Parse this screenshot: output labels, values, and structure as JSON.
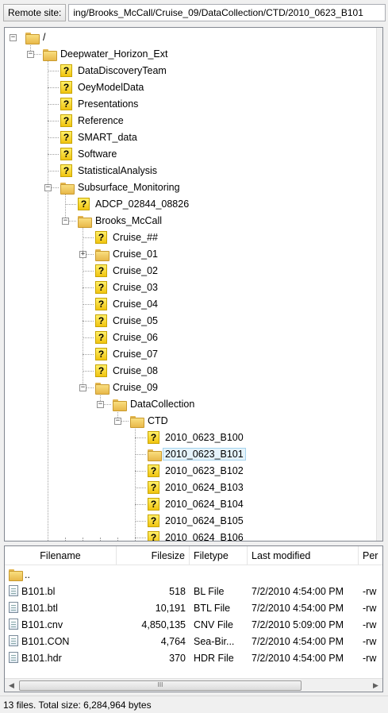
{
  "remote_site": {
    "label": "Remote site:",
    "path": "ing/Brooks_McCall/Cruise_09/DataCollection/CTD/2010_0623_B101"
  },
  "tree": {
    "nodes": [
      {
        "label": "/",
        "icon": "folder",
        "state": "expanded"
      },
      {
        "label": "Deepwater_Horizon_Ext",
        "icon": "folder",
        "state": "expanded"
      },
      {
        "label": "DataDiscoveryTeam",
        "icon": "unknown-folder"
      },
      {
        "label": "OeyModelData",
        "icon": "unknown-folder"
      },
      {
        "label": "Presentations",
        "icon": "unknown-folder"
      },
      {
        "label": "Reference",
        "icon": "unknown-folder"
      },
      {
        "label": "SMART_data",
        "icon": "unknown-folder"
      },
      {
        "label": "Software",
        "icon": "unknown-folder"
      },
      {
        "label": "StatisticalAnalysis",
        "icon": "unknown-folder"
      },
      {
        "label": "Subsurface_Monitoring",
        "icon": "folder",
        "state": "expanded"
      },
      {
        "label": "ADCP_02844_08826",
        "icon": "unknown-folder"
      },
      {
        "label": "Brooks_McCall",
        "icon": "folder",
        "state": "expanded"
      },
      {
        "label": "Cruise_##",
        "icon": "unknown-folder"
      },
      {
        "label": "Cruise_01",
        "icon": "folder",
        "state": "collapsed"
      },
      {
        "label": "Cruise_02",
        "icon": "unknown-folder"
      },
      {
        "label": "Cruise_03",
        "icon": "unknown-folder"
      },
      {
        "label": "Cruise_04",
        "icon": "unknown-folder"
      },
      {
        "label": "Cruise_05",
        "icon": "unknown-folder"
      },
      {
        "label": "Cruise_06",
        "icon": "unknown-folder"
      },
      {
        "label": "Cruise_07",
        "icon": "unknown-folder"
      },
      {
        "label": "Cruise_08",
        "icon": "unknown-folder"
      },
      {
        "label": "Cruise_09",
        "icon": "folder",
        "state": "expanded"
      },
      {
        "label": "DataCollection",
        "icon": "folder",
        "state": "expanded"
      },
      {
        "label": "CTD",
        "icon": "folder",
        "state": "expanded"
      },
      {
        "label": "2010_0623_B100",
        "icon": "unknown-folder"
      },
      {
        "label": "2010_0623_B101",
        "icon": "folder",
        "selected": true
      },
      {
        "label": "2010_0623_B102",
        "icon": "unknown-folder"
      },
      {
        "label": "2010_0624_B103",
        "icon": "unknown-folder"
      },
      {
        "label": "2010_0624_B104",
        "icon": "unknown-folder"
      },
      {
        "label": "2010_0624_B105",
        "icon": "unknown-folder"
      },
      {
        "label": "2010_0624_B106",
        "icon": "unknown-folder"
      }
    ]
  },
  "files": {
    "columns": [
      "Filename",
      "Filesize",
      "Filetype",
      "Last modified",
      "Per"
    ],
    "rows": [
      {
        "name": "..",
        "size": "",
        "type": "",
        "modified": "",
        "perm": "",
        "icon": "folder-icon"
      },
      {
        "name": "B101.bl",
        "size": "518",
        "type": "BL File",
        "modified": "7/2/2010 4:54:00 PM",
        "perm": "-rw",
        "icon": "file-icon"
      },
      {
        "name": "B101.btl",
        "size": "10,191",
        "type": "BTL File",
        "modified": "7/2/2010 4:54:00 PM",
        "perm": "-rw",
        "icon": "file-icon"
      },
      {
        "name": "B101.cnv",
        "size": "4,850,135",
        "type": "CNV File",
        "modified": "7/2/2010 5:09:00 PM",
        "perm": "-rw",
        "icon": "file-icon"
      },
      {
        "name": "B101.CON",
        "size": "4,764",
        "type": "Sea-Bir...",
        "modified": "7/2/2010 4:54:00 PM",
        "perm": "-rw",
        "icon": "config-file-icon"
      },
      {
        "name": "B101.hdr",
        "size": "370",
        "type": "HDR File",
        "modified": "7/2/2010 4:54:00 PM",
        "perm": "-rw",
        "icon": "file-icon"
      }
    ],
    "scroll_thumb_grip": "III"
  },
  "status": "13 files. Total size: 6,284,964 bytes"
}
